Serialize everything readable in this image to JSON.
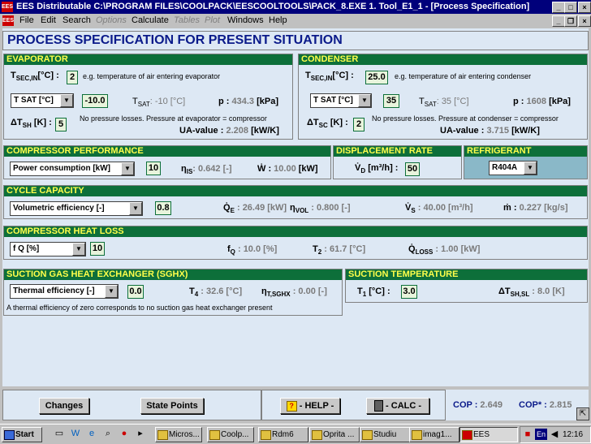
{
  "window": {
    "title": "EES Distributable  C:\\PROGRAM FILES\\COOLPACK\\EESCOOLTOOLS\\PACK_8.EXE   1. Tool_E1_1 - [Process Specification]",
    "icon_text": "EES"
  },
  "menu": {
    "items": [
      "File",
      "Edit",
      "Search",
      "Options",
      "Calculate",
      "Tables",
      "Plot",
      "Windows",
      "Help"
    ]
  },
  "page_title": "PROCESS SPECIFICATION FOR PRESENT SITUATION",
  "evaporator": {
    "header": "EVAPORATOR",
    "tsec_label": "T",
    "tsec_sub": "SEC,IN",
    "tsec_unit": "[°C] :",
    "tsec_value": "2",
    "tsec_note": "e.g. temperature of air entering evaporator",
    "mode_select": "T SAT [°C]",
    "mode_value": "-10.0",
    "tsat_label": "T",
    "tsat_sub": "SAT",
    "tsat_text": ": -10 [°C]",
    "p_label": "p :",
    "p_value": "434.3",
    "p_unit": "[kPa]",
    "dtsh_label": "ΔT",
    "dtsh_sub": "SH",
    "dtsh_unit": "[K] :",
    "dtsh_value": "5",
    "note": "No pressure losses. Pressure at evaporator = compressor",
    "ua_label": "UA-value :",
    "ua_value": "2.208",
    "ua_unit": "[kW/K]"
  },
  "condenser": {
    "header": "CONDENSER",
    "tsec_label": "T",
    "tsec_sub": "SEC,IN",
    "tsec_unit": "[°C] :",
    "tsec_value": "25.0",
    "tsec_note": "e.g. temperature of air entering condenser",
    "mode_select": "T SAT [°C]",
    "mode_value": "35",
    "tsat_label": "T",
    "tsat_sub": "SAT",
    "tsat_text": ": 35 [°C]",
    "p_label": "p :",
    "p_value": "1608",
    "p_unit": "[kPa]",
    "dtsc_label": "ΔT",
    "dtsc_sub": "SC",
    "dtsc_unit": "[K] :",
    "dtsc_value": "2",
    "note": "No pressure losses. Pressure at condenser = compressor",
    "ua_label": "UA-value :",
    "ua_value": "3.715",
    "ua_unit": "[kW/K]"
  },
  "compressor": {
    "header": "COMPRESSOR PERFORMANCE",
    "select": "Power consumption [kW]",
    "value": "10",
    "eta_label": "η",
    "eta_sub": "IS",
    "eta_text": ": 0.642 [-]",
    "w_label": "Ẇ :",
    "w_value": "10.00",
    "w_unit": "[kW]"
  },
  "displacement": {
    "header": "DISPLACEMENT RATE",
    "label": "V̇",
    "sub": "D",
    "unit": "[m³/h] :",
    "value": "50"
  },
  "refrigerant": {
    "header": "REFRIGERANT",
    "select": "R404A"
  },
  "cycle": {
    "header": "CYCLE CAPACITY",
    "select": "Volumetric efficiency [-]",
    "value": "0.8",
    "qe_label": "Q̇",
    "qe_sub": "E",
    "qe_text": ": 26.49 [kW]",
    "etavol_label": "η",
    "etavol_sub": "VOL",
    "etavol_text": ": 0.800 [-]",
    "vs_label": "V̇",
    "vs_sub": "S",
    "vs_text": ": 40.00 [m³/h]",
    "m_label": "ṁ :",
    "m_text": "0.227 [kg/s]"
  },
  "heatloss": {
    "header": "COMPRESSOR HEAT LOSS",
    "select": "f Q [%]",
    "value": "10",
    "fq_label": "f",
    "fq_sub": "Q",
    "fq_text": ": 10.0 [%]",
    "t2_label": "T",
    "t2_sub": "2",
    "t2_text": ": 61.7 [°C]",
    "qloss_label": "Q̇",
    "qloss_sub": "LOSS",
    "qloss_text": ": 1.00 [kW]"
  },
  "sghx": {
    "header": "SUCTION GAS HEAT EXCHANGER (SGHX)",
    "select": "Thermal efficiency [-]",
    "value": "0.0",
    "t4_label": "T",
    "t4_sub": "4",
    "t4_text": ": 32.6 [°C]",
    "eta_label": "η",
    "eta_sub": "T,SGHX",
    "eta_text": ": 0.00 [-]",
    "note": "A thermal efficiency of zero corresponds to no suction gas heat exchanger present"
  },
  "suction": {
    "header": "SUCTION TEMPERATURE",
    "t1_label": "T",
    "t1_sub": "1",
    "t1_unit": "[°C] :",
    "t1_value": "3.0",
    "dtsh_label": "ΔT",
    "dtsh_sub": "SH,SL",
    "dtsh_text": ": 8.0 [K]"
  },
  "bottom": {
    "changes": "Changes",
    "state_points": "State Points",
    "help": "- HELP -",
    "calc": "- CALC -",
    "cop_label": "COP :",
    "cop_value": "2.649",
    "copstar_label": "COP* :",
    "copstar_value": "2.815"
  },
  "taskbar": {
    "start": "Start",
    "tasks": [
      "Micros...",
      "Coolp...",
      "Rdm6",
      "Oprita ...",
      "Studiu",
      "imag1...",
      "EES"
    ],
    "lang": "En",
    "clock": "12:16"
  }
}
